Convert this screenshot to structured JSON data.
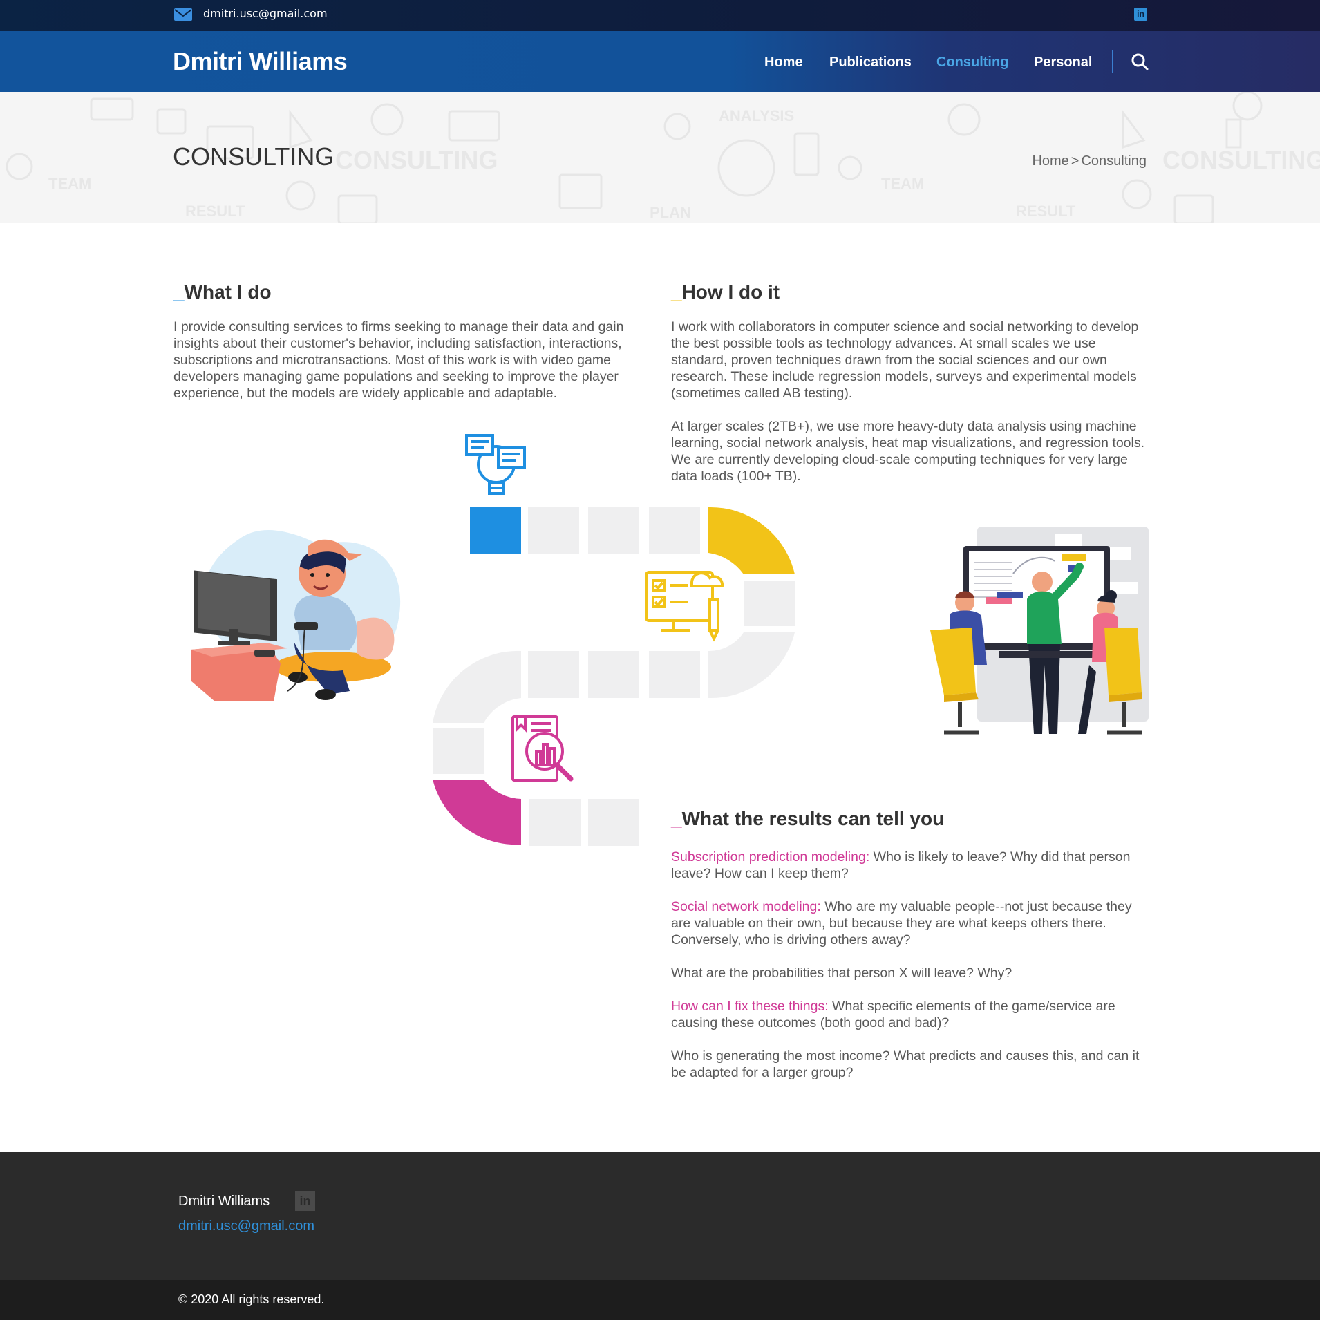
{
  "topbar": {
    "email": "dmitri.usc@gmail.com",
    "linkedin_icon": "linkedin-icon"
  },
  "nav": {
    "brand": "Dmitri Williams",
    "items": [
      {
        "label": "Home",
        "active": false
      },
      {
        "label": "Publications",
        "active": false
      },
      {
        "label": "Consulting",
        "active": true
      },
      {
        "label": "Personal",
        "active": false
      }
    ],
    "search_icon": "search-icon"
  },
  "page_header": {
    "title": "CONSULTING",
    "breadcrumb": {
      "home": "Home",
      "separator": ">",
      "current": "Consulting"
    },
    "watermark_words": [
      "CONSULTING",
      "TEAM",
      "RESULT",
      "ANALYSIS",
      "PLAN",
      "CONSULTING",
      "TEAM",
      "RESULT"
    ]
  },
  "sections": {
    "what_i_do": {
      "prefix": "_",
      "title": "What I do",
      "accent": "#1e8fe1",
      "body": "I provide consulting services to firms seeking to manage their data and gain insights about their customer's behavior, including satisfaction, interactions, subscriptions and microtransactions. Most of this work is with video game developers managing game populations and seeking to improve the player experience, but the models are widely applicable and adaptable."
    },
    "how_i_do_it": {
      "prefix": "_",
      "title": "How I do it",
      "accent": "#f2c318",
      "body1": "I work with collaborators in computer science and social networking to develop the best possible tools as technology advances. At small scales we use standard, proven techniques drawn from the social sciences and our own research. These include regression models, surveys and experimental models (sometimes called AB testing).",
      "body2": "At larger scales (2TB+), we use more heavy-duty data analysis using machine learning, social network analysis, heat map visualizations, and regression tools. We are currently developing cloud-scale computing techniques for very large data loads (100+ TB)."
    },
    "results": {
      "prefix": "_",
      "title": "What the results can tell you",
      "accent": "#d03a96",
      "items": [
        {
          "label": "Subscription prediction modeling:",
          "text": " Who is likely to leave? Why did that person leave? How can I keep them?"
        },
        {
          "label": "Social network modeling:",
          "text": " Who are my valuable people--not just because they are valuable on their own, but because they are what keeps others there. Conversely, who is driving others away?"
        },
        {
          "label": "",
          "text": "What are the probabilities that person X will leave? Why?"
        },
        {
          "label": "How can I fix these things:",
          "text": " What specific elements of the game/service are causing these outcomes (both good and bad)?"
        },
        {
          "label": "",
          "text": "Who is generating the most income? What predicts and causes this, and can it be adapted for a larger group?"
        }
      ]
    }
  },
  "illustrations": {
    "gamer": "gamer-illustration",
    "team": "team-meeting-illustration",
    "path_icons": [
      "lightbulb-chat-icon",
      "checklist-cloud-monitor-icon",
      "report-magnifier-icon"
    ],
    "colors": {
      "blue": "#1e8fe1",
      "yellow": "#f2c318",
      "magenta": "#d03a96",
      "gray": "#efeff0"
    }
  },
  "footer": {
    "name": "Dmitri Williams",
    "email": "dmitri.usc@gmail.com",
    "copyright": "© 2020 All rights reserved."
  }
}
